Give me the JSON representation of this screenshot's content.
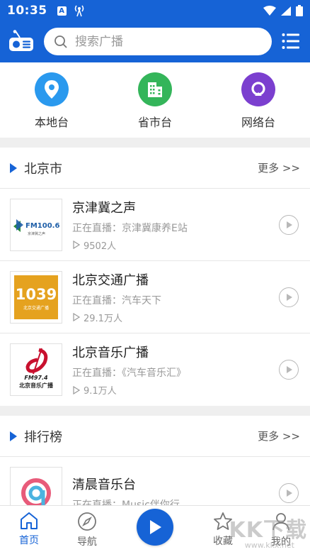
{
  "status_bar": {
    "time": "10:35",
    "a_badge": "A"
  },
  "app_bar": {
    "search_placeholder": "搜索广播"
  },
  "categories": [
    {
      "label": "本地台",
      "icon": "location-icon",
      "color": "#2a99ee"
    },
    {
      "label": "省市台",
      "icon": "building-icon",
      "color": "#34b55a"
    },
    {
      "label": "网络台",
      "icon": "network-icon",
      "color": "#7b3fcf"
    }
  ],
  "sections": [
    {
      "title": "北京市",
      "more": "更多 >>",
      "stations": [
        {
          "name": "京津冀之声",
          "now": "正在直播：京津冀康养E站",
          "count": "9502人",
          "logo_text": "FM100.6",
          "logo_sub": "京津冀之声"
        },
        {
          "name": "北京交通广播",
          "now": "正在直播：汽车天下",
          "count": "29.1万人",
          "logo_text": "1039",
          "logo_sub": "北京交通广播"
        },
        {
          "name": "北京音乐广播",
          "now": "正在直播：《汽车音乐汇》",
          "count": "9.1万人",
          "logo_text": "FM97.4",
          "logo_sub": "北京音乐广播"
        }
      ]
    },
    {
      "title": "排行榜",
      "more": "更多 >>",
      "stations": [
        {
          "name": "清晨音乐台",
          "now": "正在直播：Music伴你行",
          "count": "",
          "logo_text": "",
          "logo_sub": ""
        }
      ]
    }
  ],
  "bottom_nav": {
    "home": "首页",
    "guide": "导航",
    "favorites": "收藏",
    "mine": "我的"
  },
  "watermark": {
    "main": "KK下载",
    "sub": "www.kkx.net"
  },
  "colors": {
    "brand": "#1663d6",
    "music_red": "#c8102e",
    "traffic_gold": "#e5a21f"
  }
}
